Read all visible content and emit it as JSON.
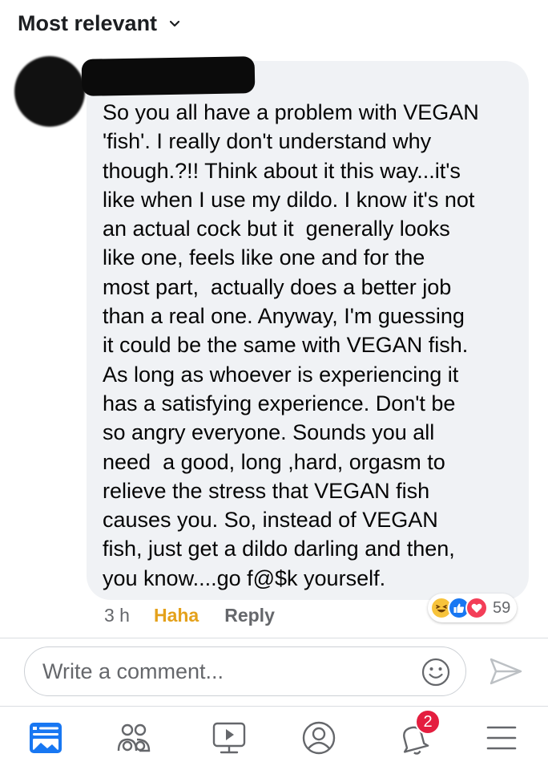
{
  "sort": {
    "label": "Most relevant"
  },
  "comment": {
    "text": "So you all have a problem with VEGAN\n'fish'. I really don't understand why\nthough.?!! Think about it this way...it's\nlike when I use my dildo. I know it's not\nan actual cock but it  generally looks\nlike one, feels like one and for the\nmost part,  actually does a better job\nthan a real one. Anyway, I'm guessing\nit could be the same with VEGAN fish.\nAs long as whoever is experiencing it\nhas a satisfying experience. Don't be\nso angry everyone. Sounds you all\nneed  a good, long ,hard, orgasm to\nrelieve the stress that VEGAN fish\ncauses you. So, instead of VEGAN\nfish, just get a dildo darling and then,\nyou know....go f@$k yourself.",
    "time": "3 h",
    "reaction_action": "Haha",
    "reply_label": "Reply",
    "reactions": {
      "icons": [
        "haha-icon",
        "like-icon",
        "love-icon"
      ],
      "count": "59"
    }
  },
  "composer": {
    "placeholder": "Write a comment..."
  },
  "tabbar": {
    "items": [
      {
        "icon": "news-feed-icon"
      },
      {
        "icon": "friends-icon"
      },
      {
        "icon": "watch-icon"
      },
      {
        "icon": "profile-icon"
      },
      {
        "icon": "notifications-icon",
        "badge": "2"
      },
      {
        "icon": "menu-icon"
      }
    ]
  },
  "colors": {
    "bubble": "#f0f2f5",
    "haha_text": "#e4a11b",
    "like": "#1877f2",
    "love": "#f33e58",
    "badge": "#e41e3f",
    "icon": "#65676b"
  }
}
